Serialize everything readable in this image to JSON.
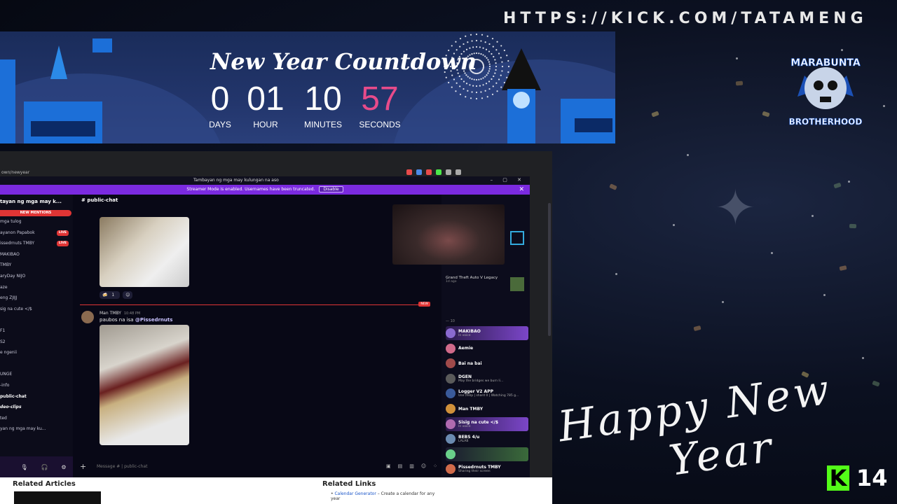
{
  "overlay": {
    "url": "HTTPS://KICK.COM/TATAMENG",
    "logo_text": "MARABUNTA\nBROTHERHOOD",
    "greeting": "Happy New Year",
    "greeting_l1": "Happy New",
    "greeting_l2": "Year",
    "kick_logo": "K",
    "viewer_count": "14"
  },
  "countdown": {
    "title": "New Year Countdown",
    "days": "0",
    "days_label": "DAYS",
    "hours": "01",
    "hours_label": "HOUR",
    "minutes": "10",
    "minutes_label": "MINUTES",
    "seconds": "57",
    "seconds_label": "SECONDS"
  },
  "browser": {
    "address": "own/newyear"
  },
  "discord": {
    "window_title": "Tambayan ng mga may kulungan na aso",
    "streamer_banner": "Streamer Mode is enabled. Usernames have been truncated.",
    "disable_label": "Disable",
    "server_name": "tayan ng mga may k...",
    "new_mentions": "NEW MENTIONS",
    "channels": [
      {
        "label": "mga tulog",
        "live": ""
      },
      {
        "label": "ayanon Papabok",
        "live": "LIVE"
      },
      {
        "label": "issedrnuts  TMBY",
        "live": "LIVE"
      },
      {
        "label": "MAKIBAO",
        "live": ""
      },
      {
        "label": "  TMBY",
        "live": ""
      },
      {
        "label": "aryDay  NIJO",
        "live": ""
      },
      {
        "label": "aze",
        "live": ""
      },
      {
        "label": "eng  ZJIJJ",
        "live": ""
      },
      {
        "label": "sig na cute  </$",
        "live": ""
      },
      {
        "label": "",
        "live": ""
      },
      {
        "label": "F1",
        "live": ""
      },
      {
        "label": "S2",
        "live": ""
      },
      {
        "label": "e ngenii",
        "live": ""
      },
      {
        "label": "",
        "live": ""
      },
      {
        "label": "UNGE",
        "live": ""
      },
      {
        "label": "-info",
        "live": ""
      },
      {
        "label": "public-chat",
        "live": ""
      },
      {
        "label": "deo-clips",
        "live": ""
      },
      {
        "label": "ted",
        "live": ""
      },
      {
        "label": "yan ng mga may ku...",
        "live": ""
      }
    ],
    "channel_header": "public-chat",
    "reaction_count": "1",
    "new_badge": "NEW",
    "message": {
      "author": "Man  TMBY",
      "time": "10:48 PM",
      "text": "paubos na isa",
      "mention": "@Pissedrnuts"
    },
    "composer_placeholder": "Message # | public-chat",
    "activities": [
      {
        "name": "Sisig na cute",
        "detail": "Farlight 84",
        "sub": "4h ago · Returning"
      },
      {
        "name": "",
        "detail": "Grand Theft Auto V Legacy",
        "sub": "1d ago"
      }
    ],
    "member_header": "— 10",
    "members": [
      {
        "name": "MAKIBAO",
        "status": "In voice"
      },
      {
        "name": "Aemie",
        "status": ""
      },
      {
        "name": "Bai na bai",
        "status": ""
      },
      {
        "name": "DGEN",
        "status": "May the bridges we burn li..."
      },
      {
        "name": "Logger V2  APP",
        "status": "Use /help | shard 0 | Watching 785 g..."
      },
      {
        "name": "Man  TMBY",
        "status": ""
      },
      {
        "name": "Sisig na cute  </$",
        "status": "In voice"
      },
      {
        "name": "BEBS  4/u",
        "status": "LALAB"
      },
      {
        "name": "",
        "status": ""
      },
      {
        "name": "Pissedrnuts  TMBY",
        "status": "Sharing their screen"
      }
    ]
  },
  "page": {
    "related_articles": "Related Articles",
    "related_links": "Related Links",
    "calendar_link": "Calendar Generator",
    "calendar_desc": " – Create a calendar for any year"
  },
  "colors": {
    "streamer_purple": "#7b2ae0",
    "live_red": "#e03535",
    "seconds_pink": "#e84b8a",
    "kick_green": "#53fc18"
  }
}
